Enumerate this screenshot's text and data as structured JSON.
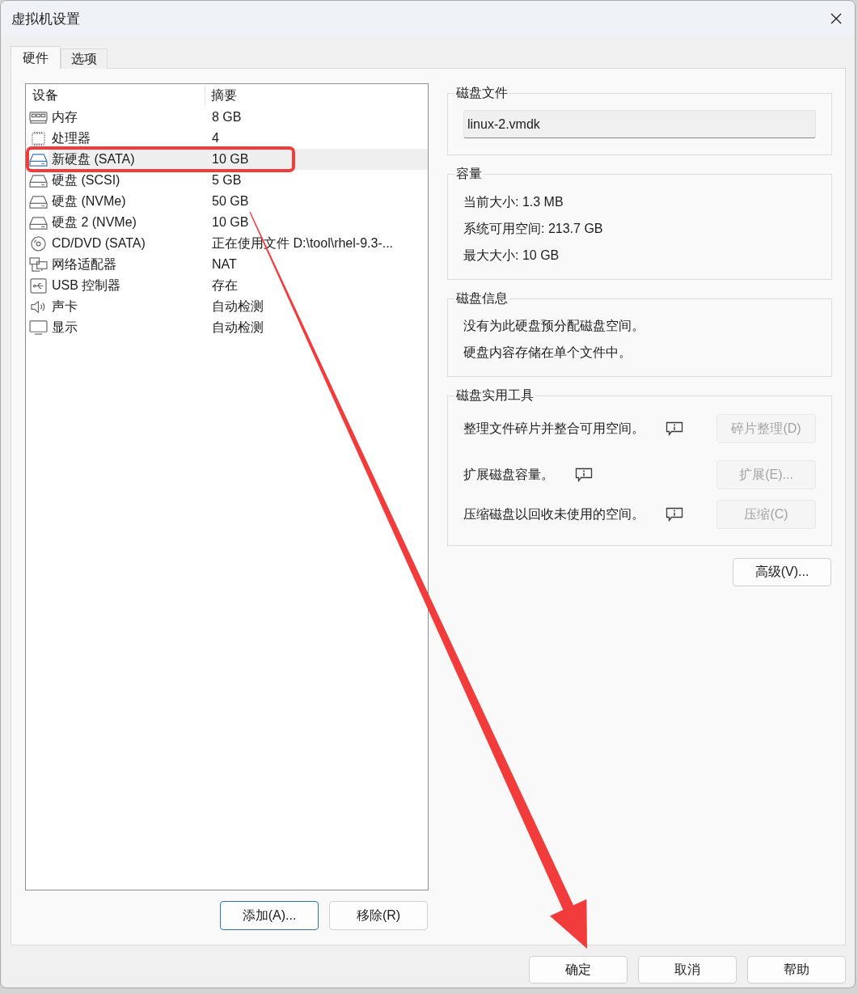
{
  "window": {
    "title": "虚拟机设置"
  },
  "tabs": [
    {
      "label": "硬件",
      "selected": true
    },
    {
      "label": "选项",
      "selected": false
    }
  ],
  "device_list": {
    "columns": [
      "设备",
      "摘要"
    ],
    "rows": [
      {
        "kind": "memory",
        "name": "内存",
        "summary": "8 GB",
        "selected": false,
        "outlined": false
      },
      {
        "kind": "processor",
        "name": "处理器",
        "summary": "4",
        "selected": false,
        "outlined": false
      },
      {
        "kind": "disk",
        "name": "新硬盘 (SATA)",
        "summary": "10 GB",
        "selected": true,
        "outlined": true
      },
      {
        "kind": "disk",
        "name": "硬盘 (SCSI)",
        "summary": "5 GB",
        "selected": false,
        "outlined": false
      },
      {
        "kind": "disk",
        "name": "硬盘 (NVMe)",
        "summary": "50 GB",
        "selected": false,
        "outlined": false
      },
      {
        "kind": "disk",
        "name": "硬盘 2 (NVMe)",
        "summary": "10 GB",
        "selected": false,
        "outlined": false
      },
      {
        "kind": "cdrom",
        "name": "CD/DVD (SATA)",
        "summary": "正在使用文件 D:\\tool\\rhel-9.3-...",
        "selected": false,
        "outlined": false
      },
      {
        "kind": "network",
        "name": "网络适配器",
        "summary": "NAT",
        "selected": false,
        "outlined": false
      },
      {
        "kind": "usb",
        "name": "USB 控制器",
        "summary": "存在",
        "selected": false,
        "outlined": false
      },
      {
        "kind": "sound",
        "name": "声卡",
        "summary": "自动检测",
        "selected": false,
        "outlined": false
      },
      {
        "kind": "display",
        "name": "显示",
        "summary": "自动检测",
        "selected": false,
        "outlined": false
      }
    ]
  },
  "list_buttons": [
    {
      "label": "添加(A)...",
      "focused": true
    },
    {
      "label": "移除(R)",
      "focused": false
    }
  ],
  "disk_file": {
    "title": "磁盘文件",
    "value": "linux-2.vmdk"
  },
  "capacity": {
    "title": "容量",
    "lines": [
      "当前大小: 1.3 MB",
      "系统可用空间: 213.7 GB",
      "最大大小: 10 GB"
    ]
  },
  "disk_info": {
    "title": "磁盘信息",
    "lines": [
      "没有为此硬盘预分配磁盘空间。",
      "硬盘内容存储在单个文件中。"
    ]
  },
  "disk_utilities": {
    "title": "磁盘实用工具",
    "rows": [
      {
        "text": "整理文件碎片并整合可用空间。",
        "button": "碎片整理(D)",
        "disabled": true
      },
      {
        "text": "扩展磁盘容量。",
        "button": "扩展(E)...",
        "disabled": true
      },
      {
        "text": "压缩磁盘以回收未使用的空间。",
        "button": "压缩(C)",
        "disabled": true
      }
    ]
  },
  "advanced_button": {
    "label": "高级(V)..."
  },
  "dialog_buttons": [
    {
      "label": "确定",
      "arrow_target": true
    },
    {
      "label": "取消",
      "arrow_target": false
    },
    {
      "label": "帮助",
      "arrow_target": false
    }
  ]
}
